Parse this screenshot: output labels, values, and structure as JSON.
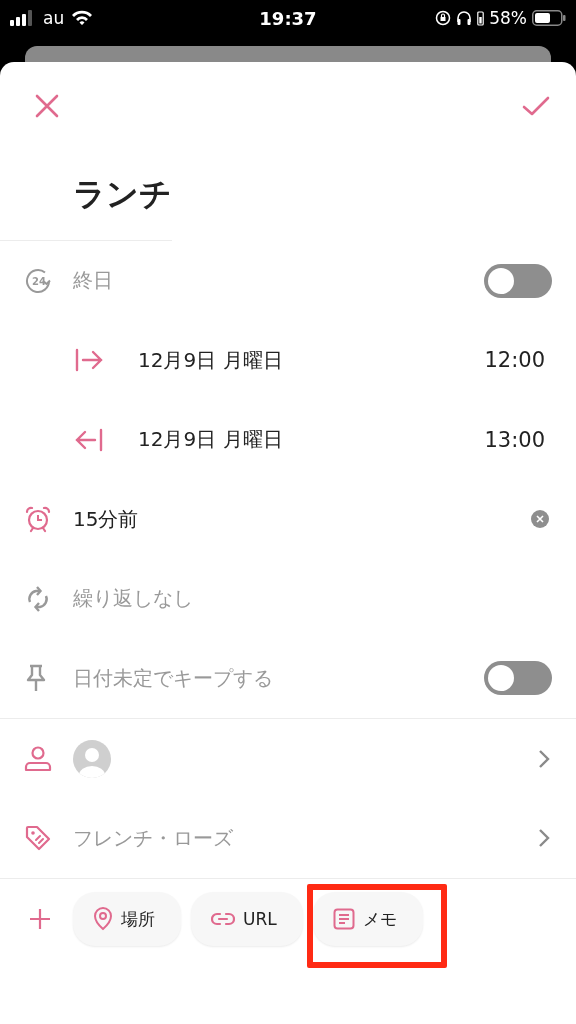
{
  "status_bar": {
    "carrier": "au",
    "time": "19:37",
    "battery": "58%"
  },
  "title": "ランチ",
  "sections": [
    {
      "rows": [
        {
          "kind": "all_day",
          "icon_text": "24",
          "label": "終日",
          "muted": true,
          "on": false
        },
        {
          "kind": "start",
          "label": "12月9日 月曜日",
          "time": "12:00",
          "muted": false
        },
        {
          "kind": "end",
          "label": "12月9日 月曜日",
          "time": "13:00",
          "muted": false
        },
        {
          "kind": "reminder",
          "label": "15分前",
          "muted": false
        },
        {
          "kind": "repeat",
          "label": "繰り返しなし",
          "muted": true
        },
        {
          "kind": "keep",
          "label": "日付未定でキープする",
          "muted": true,
          "on": false
        }
      ]
    },
    {
      "rows": [
        {
          "kind": "person"
        },
        {
          "kind": "tag",
          "label": "フレンチ・ローズ",
          "muted": true
        }
      ]
    }
  ],
  "chips": [
    {
      "kind": "place",
      "label": "場所",
      "highlighted": false
    },
    {
      "kind": "url",
      "label": "URL",
      "highlighted": false
    },
    {
      "kind": "memo",
      "label": "メモ",
      "highlighted": true
    }
  ]
}
